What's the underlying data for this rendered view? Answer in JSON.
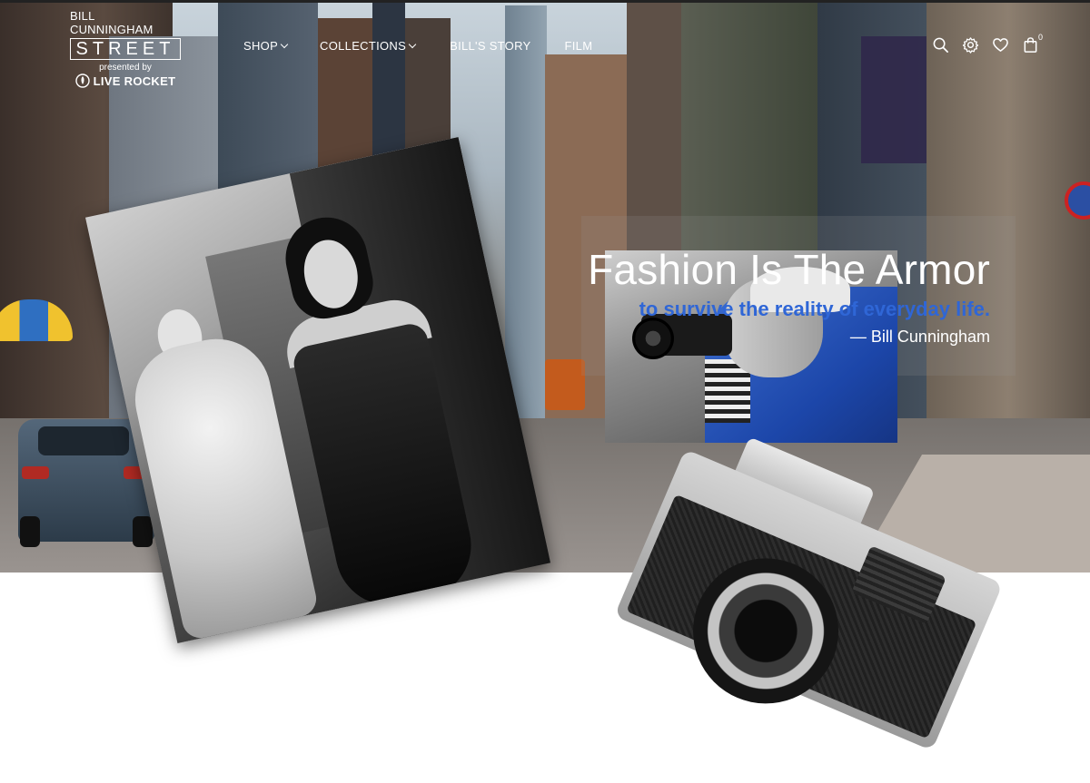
{
  "brand": {
    "top": "BILL CUNNINGHAM",
    "main": "STREET",
    "presented": "presented by",
    "sponsor": "LIVE ROCKET"
  },
  "nav": {
    "shop": "SHOP",
    "collections": "COLLECTIONS",
    "story": "BILL'S STORY",
    "film": "FILM"
  },
  "header_icons": [
    "search-icon",
    "gear-icon",
    "heart-icon",
    "shopping-bag-icon"
  ],
  "cart": {
    "count": "0"
  },
  "hero": {
    "title": "Fashion Is The Armor",
    "subtitle": "to survive the reality of everyday life.",
    "author": "— Bill Cunningham"
  },
  "colors": {
    "accent_blue": "#2f66d6",
    "text": "#ffffff"
  }
}
